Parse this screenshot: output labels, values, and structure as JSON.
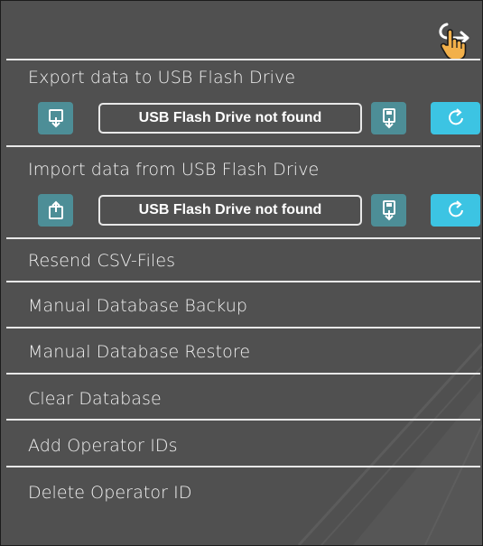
{
  "export": {
    "label": "Export data to USB Flash Drive",
    "status": "USB Flash Drive not found"
  },
  "import": {
    "label": "Import data from USB Flash Drive",
    "status": "USB Flash Drive not found"
  },
  "menu": {
    "items": [
      {
        "label": "Resend CSV-Files"
      },
      {
        "label": "Manual Database Backup"
      },
      {
        "label": "Manual Database Restore"
      },
      {
        "label": "Clear Database"
      },
      {
        "label": "Add Operator IDs"
      },
      {
        "label": "Delete Operator ID"
      }
    ]
  },
  "icons": {
    "exit": "exit-arrow-icon",
    "cursor": "hand-pointer-icon",
    "export": "export-monitor-icon",
    "import": "import-monitor-icon",
    "usb": "usb-drive-icon",
    "refresh": "refresh-icon"
  },
  "colors": {
    "background": "#505050",
    "divider": "#e8e8e8",
    "button_dim": "#4d8e97",
    "button_bright": "#3cc4e3",
    "text": "#f2f2f2"
  }
}
